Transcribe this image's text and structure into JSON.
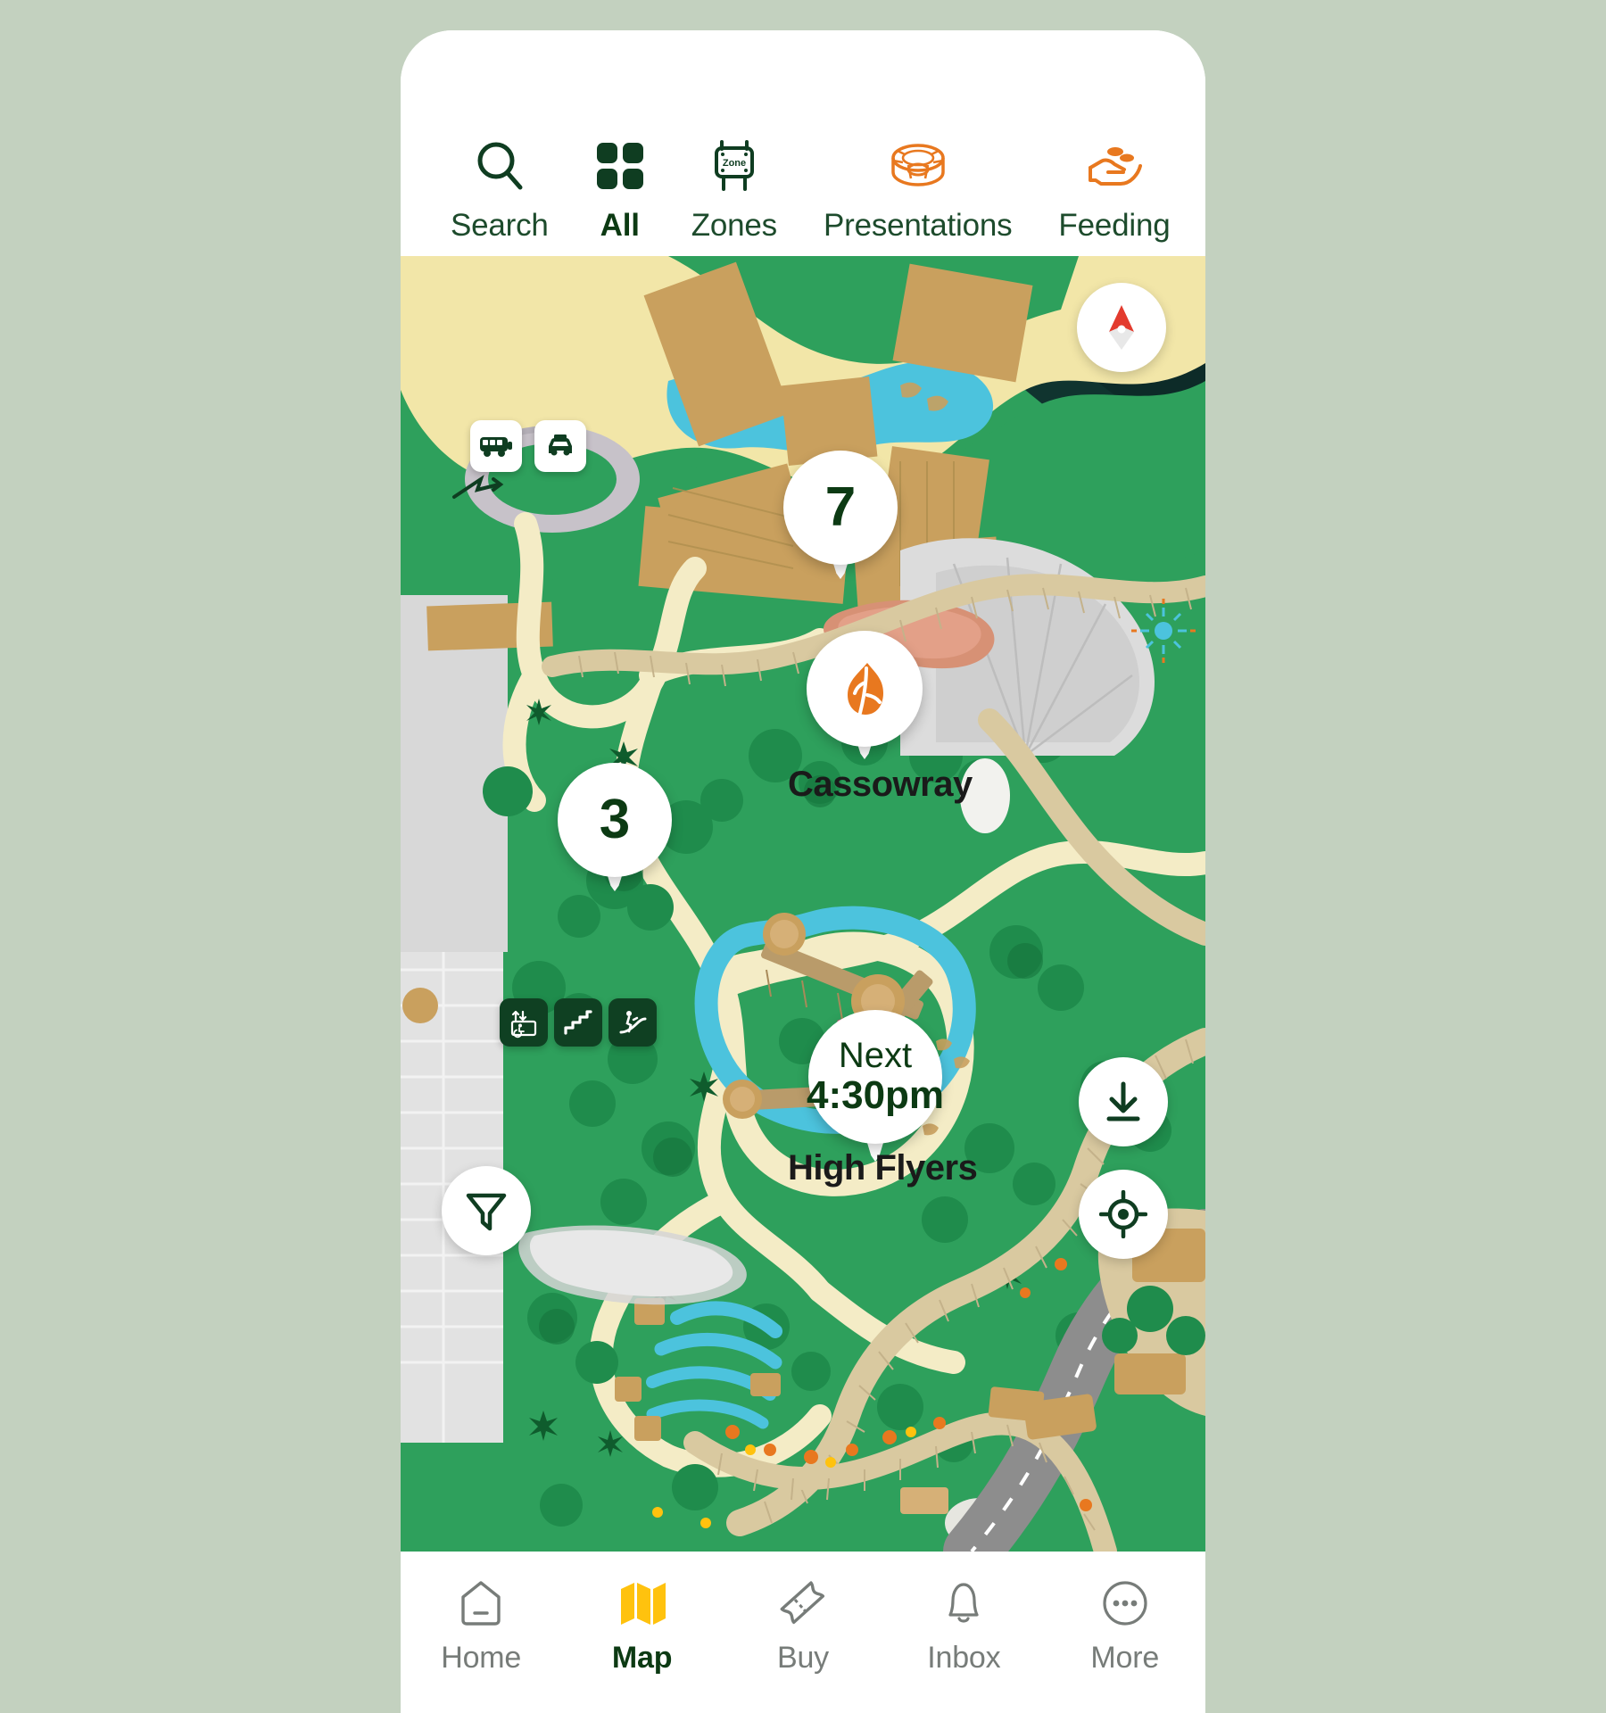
{
  "app": {
    "screen_name": "Park Map",
    "frame_background": "#c3d1bf"
  },
  "top_tabs": {
    "items": [
      {
        "id": "search",
        "label": "Search",
        "icon": "search-icon",
        "active": false,
        "color": "#1d4b2c"
      },
      {
        "id": "all",
        "label": "All",
        "icon": "grid-icon",
        "active": true,
        "color": "#0c3a13"
      },
      {
        "id": "zones",
        "label": "Zones",
        "icon": "zone-sign-icon",
        "active": false,
        "color": "#1d4b2c"
      },
      {
        "id": "presentations",
        "label": "Presentations",
        "icon": "amphitheatre-icon",
        "active": false,
        "color": "#e8781f"
      },
      {
        "id": "feeding",
        "label": "Feeding",
        "icon": "hand-feeding-icon",
        "active": false,
        "color": "#e8781f"
      }
    ],
    "zone_sign_text": "Zone"
  },
  "map": {
    "pins": [
      {
        "id": "cluster-7",
        "type": "cluster",
        "value": "7"
      },
      {
        "id": "cluster-3",
        "type": "cluster",
        "value": "3"
      },
      {
        "id": "cassowray",
        "type": "poi",
        "icon": "orange-leaf-icon",
        "label": "Cassowray"
      },
      {
        "id": "high-flyers",
        "type": "event",
        "line1": "Next",
        "line2": "4:30pm",
        "label": "High Flyers"
      }
    ],
    "transport_badges": [
      {
        "id": "bus",
        "icon": "bus-icon"
      },
      {
        "id": "taxi",
        "icon": "taxi-icon"
      }
    ],
    "access_badges": [
      {
        "id": "elevator",
        "icon": "elevator-accessible-icon"
      },
      {
        "id": "stairs",
        "icon": "stairs-icon"
      },
      {
        "id": "escalator",
        "icon": "escalator-icon"
      }
    ],
    "controls": [
      {
        "id": "compass",
        "icon": "compass-icon",
        "position": "top-right"
      },
      {
        "id": "download",
        "icon": "download-icon",
        "position": "bottom-right"
      },
      {
        "id": "locate",
        "icon": "locate-icon",
        "position": "bottom-right"
      },
      {
        "id": "filter",
        "icon": "filter-icon",
        "position": "bottom-left"
      }
    ],
    "colors": {
      "grass": "#2ea05c",
      "grass_dark": "#1f8c4c",
      "path": "#f4ecc6",
      "water": "#4cc3dd",
      "building": "#c9a05e",
      "sand": "#d9c9a0",
      "road": "#8d8d8d",
      "forest_dark": "#0f3d21",
      "accent_orange": "#e8781f",
      "pin_text": "#0c3a13"
    }
  },
  "bottom_nav": {
    "items": [
      {
        "id": "home",
        "label": "Home",
        "icon": "home-icon",
        "active": false
      },
      {
        "id": "map",
        "label": "Map",
        "icon": "map-icon",
        "active": true
      },
      {
        "id": "buy",
        "label": "Buy",
        "icon": "ticket-icon",
        "active": false
      },
      {
        "id": "inbox",
        "label": "Inbox",
        "icon": "bell-icon",
        "active": false
      },
      {
        "id": "more",
        "label": "More",
        "icon": "ellipsis-icon",
        "active": false
      }
    ],
    "active_color": "#ffc20e",
    "inactive_color": "#777c79"
  }
}
